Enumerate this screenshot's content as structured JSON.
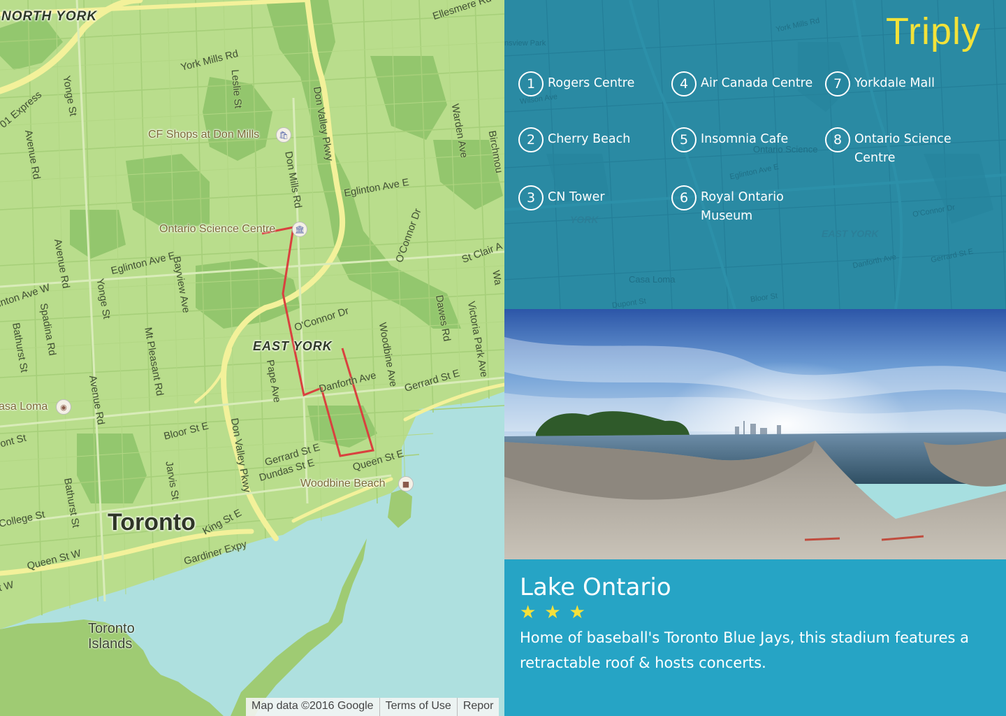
{
  "map": {
    "labels": {
      "north_york": "NORTH YORK",
      "east_york": "EAST YORK",
      "toronto": "Toronto",
      "toronto_islands": "Toronto Islands",
      "casa_loma": "asa Loma",
      "cf_shops": "CF Shops at Don Mills",
      "ontario_science_centre": "Ontario Science Centre",
      "woodbine_beach": "Woodbine Beach",
      "ellesmere": "Ellesmere Rd",
      "york_mills": "York Mills Rd",
      "express": "01 Express",
      "yonge_1": "Yonge St",
      "leslie": "Leslie St",
      "don_valley_1": "Don Valley Pkwy",
      "warden": "Warden Ave",
      "birchmount": "Birchmou",
      "avenue_rd_1": "Avenue Rd",
      "don_mills": "Don Mills Rd",
      "eglinton_1": "Eglinton Ave E",
      "oconnor_1": "O'Connor Dr",
      "st_clair": "St Clair A",
      "avenue_rd_2": "Avenue Rd",
      "eglinton_2": "Eglinton Ave E",
      "bayview": "Bayview Ave",
      "yonge_2": "Yonge St",
      "eglinton_w": "inton Ave W",
      "spadina": "Spadina Rd",
      "bathurst_1": "Bathurst St",
      "mt_pleasant": "Mt Pleasant Rd",
      "oconnor_2": "O'Connor Dr",
      "woodbine": "Woodbine Ave",
      "dawes": "Dawes Rd",
      "victoria_park": "Victoria Park Ave",
      "pape": "Pape Ave",
      "danforth": "Danforth Ave",
      "gerrard_1": "Gerrard St E",
      "avenue_rd_3": "Avenue Rd",
      "bloor": "Bloor St E",
      "don_valley_2": "Don Valley Pkwy",
      "gerrard_2": "Gerrard St E",
      "dundas": "Dundas St E",
      "queen_e": "Queen St E",
      "jarvis": "Jarvis St",
      "bathurst_2": "Bathurst St",
      "college": "College St",
      "king": "King St E",
      "gardiner": "Gardiner Expy",
      "queen_w": "Queen St W",
      "front_st": "ont St",
      "st_w": "t W",
      "wa": "Wa"
    },
    "footer": {
      "data": "Map data ©2016 Google",
      "terms": "Terms of Use",
      "report": "Repor"
    },
    "route_color": "#d9413f"
  },
  "panel": {
    "brand": "Triply",
    "brand_color": "#f2e23a",
    "places": [
      {
        "num": "1",
        "name": "Rogers Centre"
      },
      {
        "num": "2",
        "name": "Cherry Beach"
      },
      {
        "num": "3",
        "name": "CN Tower"
      },
      {
        "num": "4",
        "name": "Air Canada Centre"
      },
      {
        "num": "5",
        "name": "Insomnia Cafe"
      },
      {
        "num": "6",
        "name": "Royal Ontario Museum"
      },
      {
        "num": "7",
        "name": "Yorkdale Mall"
      },
      {
        "num": "8",
        "name": "Ontario Science Centre"
      }
    ],
    "background_map": {
      "york": "YORK",
      "east_york": "EAST YORK",
      "casa_loma": "Casa Loma",
      "ontario_science": "Ontario Science",
      "york_mills": "York Mills Rd",
      "eglinton": "Eglinton Ave E",
      "danforth": "Danforth Ave",
      "gerrard": "Gerrard St E",
      "dupont": "Dupont St",
      "bloor": "Bloor St",
      "oconnor": "O'Connor Dr",
      "wilson": "Wilson Ave",
      "parkview": "nsview Park"
    },
    "detail": {
      "title": "Lake Ontario",
      "rating": 3,
      "rating_max": 3,
      "star_glyph": "★",
      "description": "Home of baseball's Toronto Blue Jays, this stadium features a retractable roof & hosts concerts."
    }
  },
  "colors": {
    "land": "#b9dd8c",
    "park": "#8fc46a",
    "water": "#aee0df",
    "highway": "#f3f19a",
    "panel_top": "#2a8aa3",
    "panel_bottom": "#26a4c5",
    "star": "#f6e03a"
  }
}
